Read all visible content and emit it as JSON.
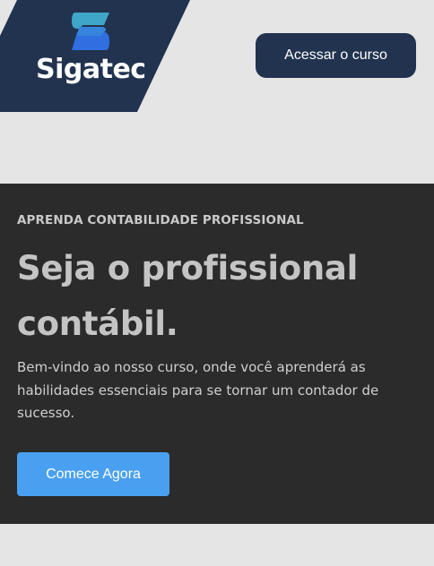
{
  "header": {
    "logo": {
      "icon": "sigatec-s-mark-icon",
      "text": "Sigatec"
    },
    "cta_label": "Acessar o curso"
  },
  "hero": {
    "eyebrow": "APRENDA CONTABILIDADE PROFISSIONAL",
    "title": "Seja o profissional contábil.",
    "description": "Bem-vindo ao nosso curso, onde você aprenderá as habilidades essenciais para se tornar um contador de sucesso.",
    "cta_label": "Comece Agora"
  },
  "colors": {
    "page_bg": "#e5e5e5",
    "logo_bg": "#22334f",
    "top_button_bg": "#22334f",
    "hero_bg": "#2b2b2b",
    "hero_text": "#c4c4c4",
    "primary_button_bg": "#4aa0f0",
    "logo_mark_light": "#3fa6c9",
    "logo_mark_dark": "#2f6fe0"
  }
}
